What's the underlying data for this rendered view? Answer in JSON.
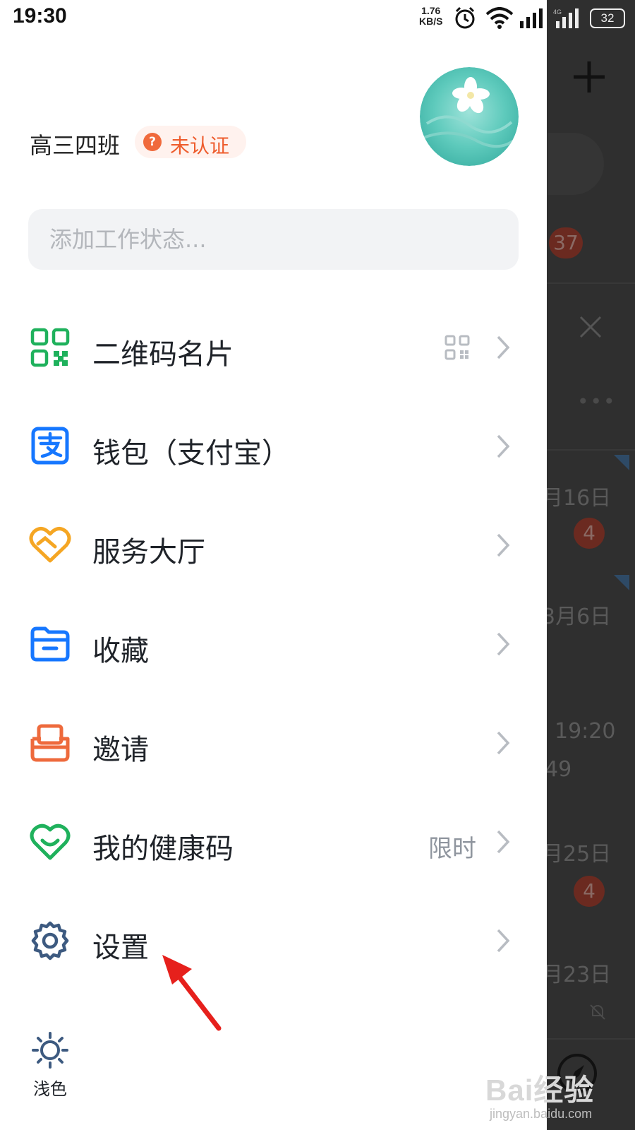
{
  "status_bar": {
    "time": "19:30",
    "net_speed": "1.76",
    "net_unit": "KB/S",
    "battery": "32"
  },
  "profile": {
    "name": "高三四班",
    "verify_badge": "未认证"
  },
  "work_status": {
    "placeholder": "添加工作状态..."
  },
  "menu": {
    "qrcode": {
      "label": "二维码名片",
      "icon": "qrcode-icon"
    },
    "wallet": {
      "label": "钱包（支付宝）",
      "icon": "alipay-icon"
    },
    "service": {
      "label": "服务大厅",
      "icon": "service-hall-icon"
    },
    "favorites": {
      "label": "收藏",
      "icon": "folder-icon"
    },
    "invite": {
      "label": "邀请",
      "icon": "invite-icon"
    },
    "health": {
      "label": "我的健康码",
      "icon": "health-heart-icon",
      "extra": "限时"
    },
    "settings": {
      "label": "设置",
      "icon": "gear-icon"
    }
  },
  "theme": {
    "label": "浅色",
    "icon": "sun-icon"
  },
  "background_app": {
    "badge_count": "37",
    "date1": "月16日",
    "badge1": "4",
    "date2": "3月6日",
    "time1": "19:20",
    "num1": "49",
    "date3": "月25日",
    "badge2": "4",
    "date4": "月23日"
  },
  "watermark": {
    "brand": "Bai经验",
    "url": "jingyan.baidu.com"
  },
  "colors": {
    "accent_red": "#ee5d2e",
    "qr_green": "#1fb15c",
    "alipay_blue": "#1677ff",
    "service_yellow": "#f5a623",
    "invite_orange": "#ee6a3c",
    "health_green": "#1fb15c",
    "settings_blue": "#3d5a80"
  }
}
